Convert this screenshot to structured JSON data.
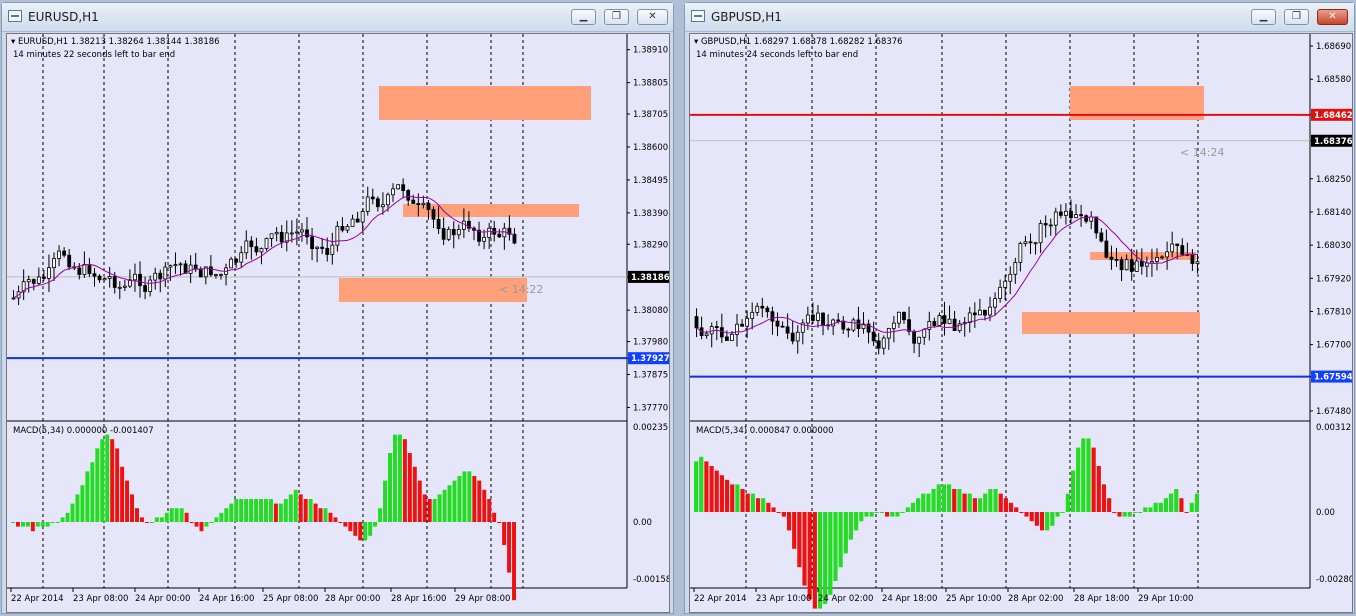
{
  "windows": [
    {
      "title": "EURUSD,H1",
      "header": "EURUSD,H1  1.38213 1.38264 1.38144 1.38186",
      "subheader": "14 minutes 22 seconds left to bar end",
      "countdown": "< 14:22",
      "macd_label": "MACD(5,34) 0.000000 -0.001407",
      "price_axis": [
        "1.38910",
        "1.38805",
        "1.38705",
        "1.38600",
        "1.38495",
        "1.38390",
        "1.38290",
        "1.38186",
        "1.38080",
        "1.37980",
        "1.37927",
        "1.37875",
        "1.37770"
      ],
      "price_tags": [
        {
          "label": "1.38186",
          "price": 1.38186,
          "bg": "#000000",
          "fg": "#ffffff"
        },
        {
          "label": "1.37927",
          "price": 1.37927,
          "bg": "#1040ff",
          "fg": "#ffffff"
        }
      ],
      "macd_axis": [
        "0.002351",
        "0.00",
        "-0.001586"
      ],
      "time_axis": [
        "22 Apr 2014",
        "23 Apr 08:00",
        "24 Apr 00:00",
        "24 Apr 16:00",
        "25 Apr 08:00",
        "28 Apr 00:00",
        "28 Apr 16:00",
        "29 Apr 08:00"
      ],
      "hline_price": 1.37927,
      "colors": {
        "hline": "#1030e0",
        "zone": "#ffa07a",
        "sma": "#9900aa",
        "up": "#22dd22",
        "down": "#ee1111"
      }
    },
    {
      "title": "GBPUSD,H1",
      "header": "GBPUSD,H1  1.68297 1.68378 1.68282 1.68376",
      "subheader": "14 minutes 24 seconds left to bar end",
      "countdown": "< 14:24",
      "macd_label": "MACD(5,34) 0.000847 0.000000",
      "price_axis": [
        "1.68690",
        "1.68580",
        "1.68462",
        "1.68376",
        "1.68250",
        "1.68140",
        "1.68030",
        "1.67920",
        "1.67810",
        "1.67700",
        "1.67594",
        "1.67480"
      ],
      "price_tags": [
        {
          "label": "1.68462",
          "price": 1.68462,
          "bg": "#e01010",
          "fg": "#ffffff"
        },
        {
          "label": "1.68376",
          "price": 1.68376,
          "bg": "#000000",
          "fg": "#ffffff"
        },
        {
          "label": "1.67594",
          "price": 1.67594,
          "bg": "#1040ff",
          "fg": "#ffffff"
        }
      ],
      "macd_axis": [
        "0.003121",
        "0.00",
        "-0.002805"
      ],
      "time_axis": [
        "22 Apr 2014",
        "23 Apr 10:00",
        "24 Apr 02:00",
        "24 Apr 18:00",
        "25 Apr 10:00",
        "28 Apr 02:00",
        "28 Apr 18:00",
        "29 Apr 10:00"
      ],
      "hline_price": 1.67594,
      "hline2_price": 1.68462,
      "colors": {
        "hline": "#1030e0",
        "hline2": "#e01010",
        "zone": "#ffa07a",
        "sma": "#9900aa",
        "up": "#22dd22",
        "down": "#ee1111"
      }
    }
  ],
  "buttons": {
    "minimize": "▁",
    "maximize": "❐",
    "close": "✕"
  }
}
